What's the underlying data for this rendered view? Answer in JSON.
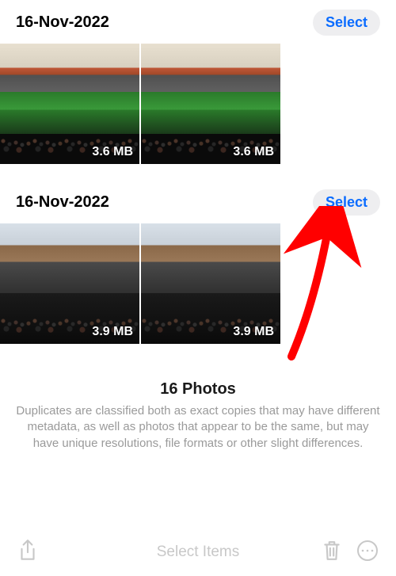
{
  "groups": [
    {
      "date": "16-Nov-2022",
      "select_label": "Select",
      "photos": [
        {
          "size": "3.6 MB"
        },
        {
          "size": "3.6 MB"
        }
      ]
    },
    {
      "date": "16-Nov-2022",
      "select_label": "Select",
      "photos": [
        {
          "size": "3.9 MB"
        },
        {
          "size": "3.9 MB"
        }
      ]
    }
  ],
  "footer": {
    "title": "16 Photos",
    "description": "Duplicates are classified both as exact copies that may have different metadata, as well as photos that appear to be the same, but may have unique resolutions, file formats or other slight differences."
  },
  "toolbar": {
    "center_label": "Select Items"
  }
}
